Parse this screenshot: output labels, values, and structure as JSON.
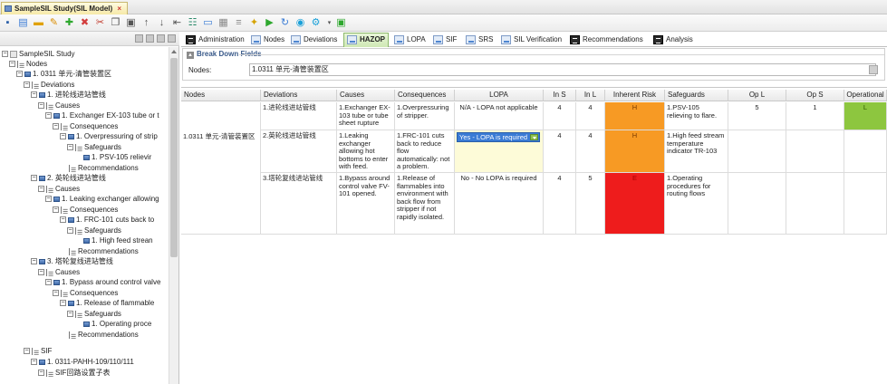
{
  "app": {
    "doc_tab_title": "SampleSIL Study(SIL Model)",
    "doc_tab_close": "×"
  },
  "tree": {
    "root": "SampleSIL Study",
    "nodes_label": "Nodes",
    "node1": "1. 0311 单元-清管装置区",
    "deviations": "Deviations",
    "dev1": "1. 进轮线进站管线",
    "causes": "Causes",
    "cause1": "1. Exchanger EX-103 tube or t",
    "consequences": "Consequences",
    "cons1": "1. Overpressuring of strip",
    "safeguards": "Safeguards",
    "sg1": "1. PSV-105 relievir",
    "recommendations": "Recommendations",
    "dev2": "2. 英轮线进站管线",
    "cause2": "1. Leaking exchanger allowing",
    "cons2": "1. FRC-101 cuts back to",
    "sg2": "1. High feed strean",
    "dev3": "3. 塔轮复线进站管线",
    "cause3": "1. Bypass around control valve",
    "cons3": "1. Release of flammable",
    "sg3": "1. Operating proce",
    "sif": "SIF",
    "sif1": "1. 0311-PAHH-109/110/111",
    "sif_sub": "SIF回路设置子表"
  },
  "tabs": [
    {
      "label": "Administration",
      "icon": "dark"
    },
    {
      "label": "Nodes",
      "icon": "blue"
    },
    {
      "label": "Deviations",
      "icon": "blue"
    },
    {
      "label": "HAZOP",
      "icon": "blue"
    },
    {
      "label": "LOPA",
      "icon": "blue"
    },
    {
      "label": "SIF",
      "icon": "blue"
    },
    {
      "label": "SRS",
      "icon": "blue"
    },
    {
      "label": "SIL Verification",
      "icon": "blue"
    },
    {
      "label": "Recommendations",
      "icon": "dark"
    },
    {
      "label": "Analysis",
      "icon": "dark"
    }
  ],
  "breakdown": {
    "title": "Break Down Fields",
    "nodes_label": "Nodes:",
    "nodes_value": "1.0311 单元-清管装置区"
  },
  "grid": {
    "headers": [
      "Nodes",
      "Deviations",
      "Causes",
      "Consequences",
      "LOPA",
      "In S",
      "In L",
      "Inherent Risk",
      "Safeguards",
      "Op L",
      "Op S",
      "Operational"
    ],
    "node_cell": "1.0311 单元-清管装置区",
    "rows": [
      {
        "deviation": "1.进轮线进站管线",
        "cause": "1.Exchanger EX-103 tube or tube sheet rupture",
        "consequence": "1.Overpressuring of stripper.",
        "lopa": "N/A - LOPA not applicable",
        "in_s": "4",
        "in_l": "4",
        "risk": "H",
        "safeguard": "1.PSV-105 relieving to flare.",
        "op_l": "5",
        "op_s": "1",
        "operational": "L"
      },
      {
        "deviation": "2.英轮线进站管线",
        "cause": "1.Leaking exchanger allowing hot bottoms to enter with feed.",
        "consequence": "1.FRC-101 cuts back to reduce flow automatically: not a problem.",
        "lopa": "Yes - LOPA is required",
        "in_s": "4",
        "in_l": "4",
        "risk": "H",
        "safeguard": "1.High feed stream temperature indicator TR-103",
        "op_l": "",
        "op_s": "",
        "operational": ""
      },
      {
        "deviation": "3.塔轮复线进站管线",
        "cause": "1.Bypass around control valve FV-101 opened.",
        "consequence": "1.Release of flammables into environment with back flow from stripper if not rapidly isolated.",
        "lopa": "No - No LOPA is required",
        "in_s": "4",
        "in_l": "5",
        "risk": "E",
        "safeguard": "1.Operating procedures for routing flows",
        "op_l": "",
        "op_s": "",
        "operational": ""
      }
    ]
  },
  "colors": {
    "risk_high": "#f79a24",
    "risk_extreme": "#ee1c1c",
    "risk_low": "#8dc63f",
    "lopa_selected": "#3a7bd5"
  }
}
